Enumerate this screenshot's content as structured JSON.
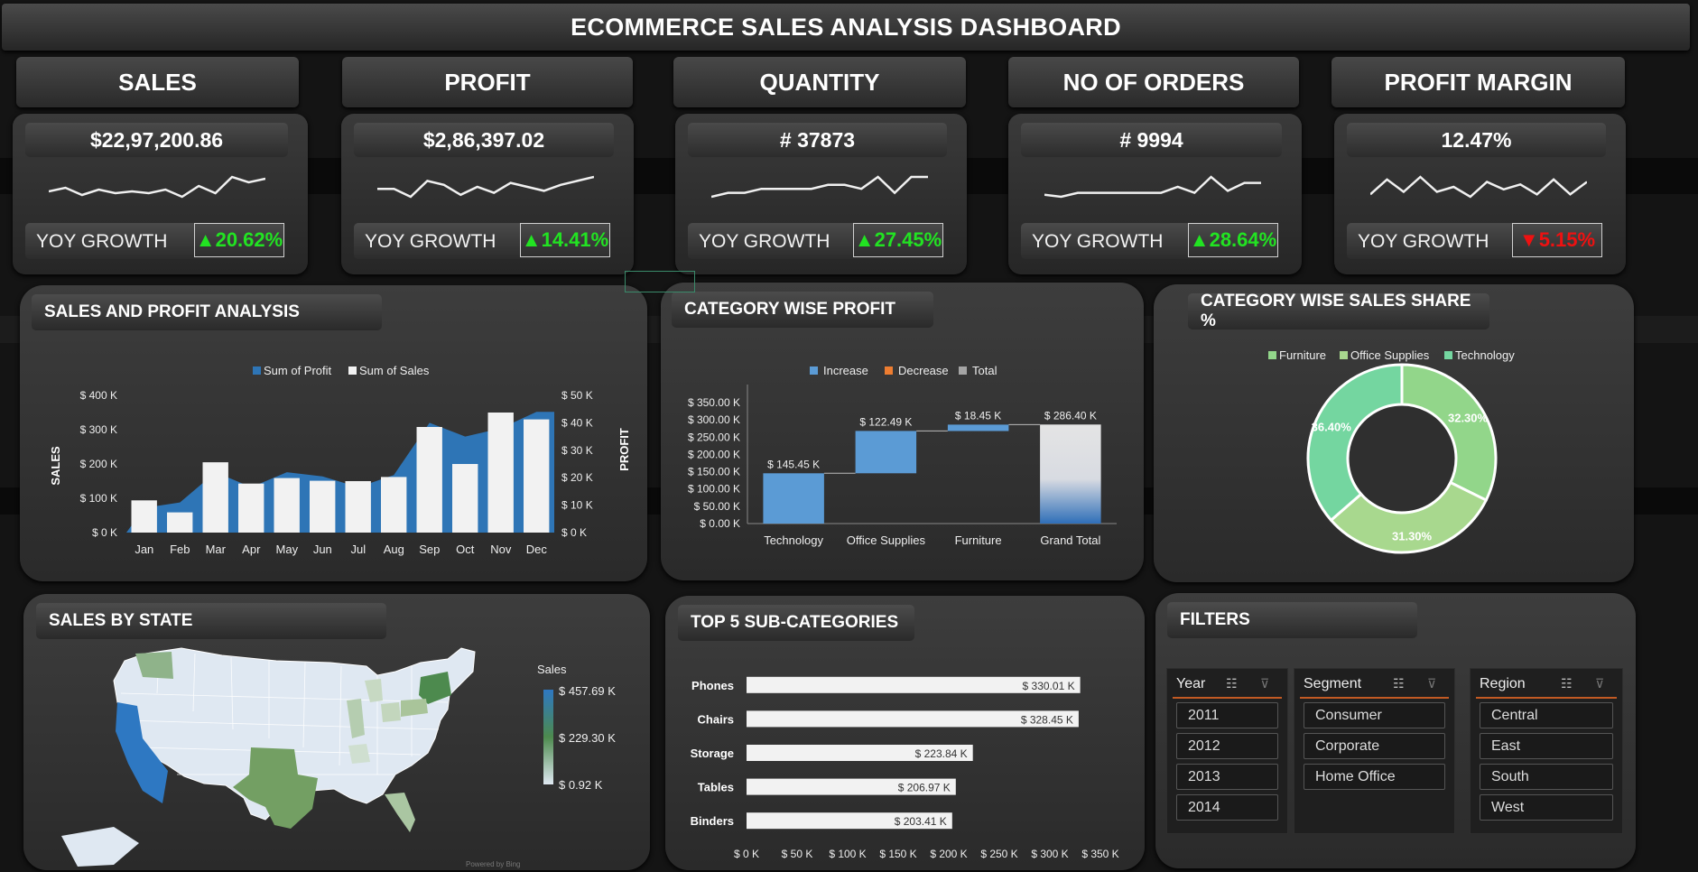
{
  "dashboard_title": "ECOMMERCE SALES ANALYSIS DASHBOARD",
  "colors": {
    "increase": "#5b9bd5",
    "decrease": "#ed7d31",
    "total": "#a5a5a5",
    "profit_area": "#2e75b6",
    "sales_bar": "#f2f2f2",
    "up": "#22e322",
    "down": "#ee1111"
  },
  "kpis": [
    {
      "label": "SALES",
      "value": "$22,97,200.86",
      "yoy_label": "YOY GROWTH",
      "arrow": "▲",
      "yoy": "20.62%",
      "direction": "up",
      "trend": [
        55,
        53,
        57,
        54,
        56,
        55,
        56,
        54,
        58,
        52,
        56,
        47,
        50,
        48
      ]
    },
    {
      "label": "PROFIT",
      "value": "$2,86,397.02",
      "yoy_label": "YOY GROWTH",
      "arrow": "▲",
      "yoy": "14.41%",
      "direction": "up",
      "trend": [
        54,
        54,
        58,
        50,
        52,
        57,
        53,
        56,
        51,
        53,
        55,
        52,
        50,
        48
      ]
    },
    {
      "label": "QUANTITY",
      "value": "# 37873",
      "yoy_label": "YOY GROWTH",
      "arrow": "▲",
      "yoy": "27.45%",
      "direction": "up",
      "trend": [
        56,
        55,
        55,
        54,
        54,
        54,
        54,
        53,
        53,
        54,
        51,
        55,
        51,
        51
      ]
    },
    {
      "label": "NO OF ORDERS",
      "value": "# 9994",
      "yoy_label": "YOY GROWTH",
      "arrow": "▲",
      "yoy": "28.64%",
      "direction": "up",
      "trend": [
        56,
        57,
        55,
        55,
        55,
        55,
        55,
        55,
        52,
        55,
        47,
        54,
        50,
        50
      ]
    },
    {
      "label": "PROFIT MARGIN",
      "value": "12.47%",
      "yoy_label": "YOY GROWTH",
      "arrow": "▼",
      "yoy": "5.15%",
      "direction": "down",
      "trend": [
        55,
        49,
        54,
        48,
        54,
        52,
        56,
        50,
        53,
        51,
        55,
        49,
        55,
        50
      ]
    }
  ],
  "panels": {
    "sales_profit": "SALES AND PROFIT ANALYSIS",
    "category_profit": "CATEGORY WISE PROFIT",
    "category_share": "CATEGORY WISE SALES SHARE %",
    "sales_state": "SALES BY STATE",
    "top5": "TOP 5 SUB-CATEGORIES",
    "filters": "FILTERS"
  },
  "chart_data": [
    {
      "type": "bar",
      "categories": [
        "Jan",
        "Feb",
        "Mar",
        "Apr",
        "May",
        "Jun",
        "Jul",
        "Aug",
        "Sep",
        "Oct",
        "Nov",
        "Dec"
      ],
      "series": [
        {
          "name": "Sum of Profit",
          "type": "area",
          "axis": "secondary",
          "values": [
            9000,
            11000,
            22000,
            16500,
            22000,
            20500,
            16500,
            21000,
            40000,
            35000,
            38000,
            44000
          ]
        },
        {
          "name": "Sum of Sales",
          "type": "bar",
          "axis": "primary",
          "values": [
            94000,
            59000,
            205000,
            143000,
            159000,
            151000,
            150000,
            162000,
            308000,
            200000,
            350000,
            330000
          ]
        }
      ],
      "legend": [
        "Sum of Profit",
        "Sum of Sales"
      ],
      "ylabel": "SALES",
      "y2label": "PROFIT",
      "yticks": [
        "$ 0 K",
        "$ 100 K",
        "$ 200 K",
        "$ 300 K",
        "$ 400 K"
      ],
      "y2ticks": [
        "$ 0 K",
        "$ 10 K",
        "$ 20 K",
        "$ 30 K",
        "$ 40 K",
        "$ 50 K"
      ],
      "ylim": [
        0,
        400000
      ],
      "y2lim": [
        0,
        50000
      ]
    },
    {
      "type": "bar",
      "subtype": "waterfall",
      "categories": [
        "Technology",
        "Office Supplies",
        "Furniture",
        "Grand Total"
      ],
      "values": [
        145.45,
        122.49,
        18.45,
        286.4
      ],
      "labels": [
        "$ 145.45 K",
        "$ 122.49 K",
        "$ 18.45 K",
        "$ 286.40 K"
      ],
      "legend": [
        "Increase",
        "Decrease",
        "Total"
      ],
      "yticks": [
        "$ 0.00 K",
        "$ 50.00 K",
        "$ 100.00 K",
        "$ 150.00 K",
        "$ 200.00 K",
        "$ 250.00 K",
        "$ 300.00 K",
        "$ 350.00 K"
      ],
      "ylim": [
        0,
        350
      ]
    },
    {
      "type": "pie",
      "subtype": "donut",
      "categories": [
        "Furniture",
        "Office Supplies",
        "Technology"
      ],
      "values": [
        32.3,
        31.3,
        36.4
      ],
      "labels": [
        "32.30%",
        "31.30%",
        "36.40%"
      ],
      "colors": [
        "#92d68a",
        "#a8d88e",
        "#74d6a0"
      ]
    },
    {
      "type": "bar",
      "orientation": "horizontal",
      "categories": [
        "Phones",
        "Chairs",
        "Storage",
        "Tables",
        "Binders"
      ],
      "values": [
        330.01,
        328.45,
        223.84,
        206.97,
        203.41
      ],
      "labels": [
        "$ 330.01 K",
        "$ 328.45 K",
        "$ 223.84 K",
        "$ 206.97 K",
        "$ 203.41 K"
      ],
      "xticks": [
        "$ 0 K",
        "$ 50 K",
        "$ 100 K",
        "$ 150 K",
        "$ 200 K",
        "$ 250 K",
        "$ 300 K",
        "$ 350 K"
      ],
      "xlim": [
        0,
        350
      ]
    }
  ],
  "map": {
    "legend_title": "Sales",
    "legend_max": "$ 457.69 K",
    "legend_mid": "$ 229.30 K",
    "legend_min": "$ 0.92 K",
    "credit": "Powered by Bing"
  },
  "filters": [
    {
      "title": "Year",
      "items": [
        "2011",
        "2012",
        "2013",
        "2014"
      ]
    },
    {
      "title": "Segment",
      "items": [
        "Consumer",
        "Corporate",
        "Home Office"
      ]
    },
    {
      "title": "Region",
      "items": [
        "Central",
        "East",
        "South",
        "West"
      ]
    }
  ]
}
